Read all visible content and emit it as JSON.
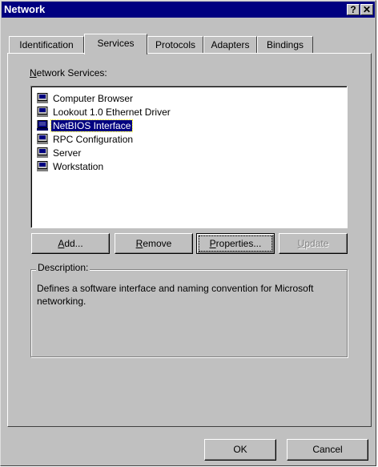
{
  "window": {
    "title": "Network",
    "help_glyph": "?",
    "close_glyph": "✕"
  },
  "tabs": [
    {
      "label": "Identification"
    },
    {
      "label": "Services"
    },
    {
      "label": "Protocols"
    },
    {
      "label": "Adapters"
    },
    {
      "label": "Bindings"
    }
  ],
  "services": {
    "label_prefix": "N",
    "label_rest": "etwork Services:",
    "items": [
      {
        "label": "Computer Browser",
        "icon": "computer-icon"
      },
      {
        "label": "Lookout 1.0 Ethernet Driver",
        "icon": "computer-icon"
      },
      {
        "label": "NetBIOS Interface",
        "icon": "computer-icon",
        "selected": true
      },
      {
        "label": "RPC Configuration",
        "icon": "computer-icon"
      },
      {
        "label": "Server",
        "icon": "computer-icon"
      },
      {
        "label": "Workstation",
        "icon": "computer-icon"
      }
    ]
  },
  "buttons": {
    "add": {
      "mnemonic": "A",
      "rest": "dd..."
    },
    "remove": {
      "mnemonic": "R",
      "rest": "emove"
    },
    "properties": {
      "mnemonic": "P",
      "rest": "roperties..."
    },
    "update": {
      "mnemonic": "U",
      "rest": "pdate"
    }
  },
  "description": {
    "title": "Description:",
    "text": "Defines a software interface and naming convention for Microsoft networking."
  },
  "footer": {
    "ok": "OK",
    "cancel": "Cancel"
  },
  "colors": {
    "titlebar": "#000080",
    "face": "#c0c0c0",
    "selection": "#000080"
  }
}
